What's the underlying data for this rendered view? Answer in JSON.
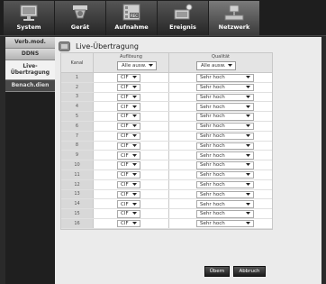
{
  "nav": {
    "tabs": [
      {
        "label": "System",
        "icon": "monitor-icon"
      },
      {
        "label": "Gerät",
        "icon": "camera-icon"
      },
      {
        "label": "Aufnahme",
        "icon": "record-icon"
      },
      {
        "label": "Ereignis",
        "icon": "event-icon"
      },
      {
        "label": "Netzwerk",
        "icon": "network-icon"
      }
    ],
    "active": "Netzwerk"
  },
  "sidebar": {
    "items": [
      {
        "label": "Verb.mod."
      },
      {
        "label": "DDNS"
      },
      {
        "label": "Live-Übertragung"
      },
      {
        "label": "Benach.dien"
      }
    ],
    "active": "Live-Übertragung"
  },
  "page": {
    "title": "Live-Übertragung"
  },
  "table": {
    "col_kanal": "Kanal",
    "col_aufloesung": "Auflösung",
    "col_qualitaet": "Qualität",
    "select_all_aufloesung": "Alle ausw.",
    "select_all_qualitaet": "Alle ausw.",
    "rows": [
      {
        "kanal": "1",
        "aufloesung": "CIF",
        "qualitaet": "Sehr hoch"
      },
      {
        "kanal": "2",
        "aufloesung": "CIF",
        "qualitaet": "Sehr hoch"
      },
      {
        "kanal": "3",
        "aufloesung": "CIF",
        "qualitaet": "Sehr hoch"
      },
      {
        "kanal": "4",
        "aufloesung": "CIF",
        "qualitaet": "Sehr hoch"
      },
      {
        "kanal": "5",
        "aufloesung": "CIF",
        "qualitaet": "Sehr hoch"
      },
      {
        "kanal": "6",
        "aufloesung": "CIF",
        "qualitaet": "Sehr hoch"
      },
      {
        "kanal": "7",
        "aufloesung": "CIF",
        "qualitaet": "Sehr hoch"
      },
      {
        "kanal": "8",
        "aufloesung": "CIF",
        "qualitaet": "Sehr hoch"
      },
      {
        "kanal": "9",
        "aufloesung": "CIF",
        "qualitaet": "Sehr hoch"
      },
      {
        "kanal": "10",
        "aufloesung": "CIF",
        "qualitaet": "Sehr hoch"
      },
      {
        "kanal": "11",
        "aufloesung": "CIF",
        "qualitaet": "Sehr hoch"
      },
      {
        "kanal": "12",
        "aufloesung": "CIF",
        "qualitaet": "Sehr hoch"
      },
      {
        "kanal": "13",
        "aufloesung": "CIF",
        "qualitaet": "Sehr hoch"
      },
      {
        "kanal": "14",
        "aufloesung": "CIF",
        "qualitaet": "Sehr hoch"
      },
      {
        "kanal": "15",
        "aufloesung": "CIF",
        "qualitaet": "Sehr hoch"
      },
      {
        "kanal": "16",
        "aufloesung": "CIF",
        "qualitaet": "Sehr hoch"
      }
    ]
  },
  "buttons": {
    "ok": "Übern",
    "cancel": "Abbruch"
  }
}
